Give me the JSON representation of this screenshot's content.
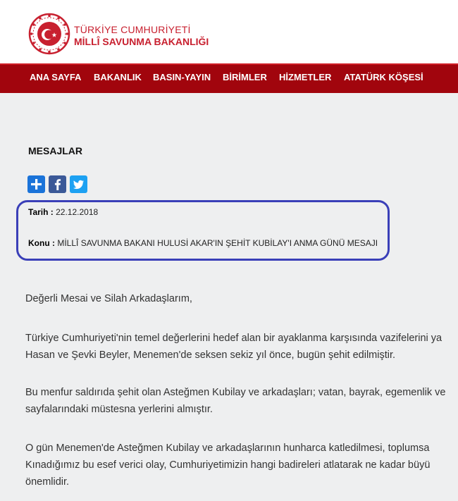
{
  "header": {
    "brand_line1": "TÜRKİYE CUMHURİYETİ",
    "brand_line2": "MİLLÎ SAVUNMA BAKANLIĞI",
    "logo_icon": "crescent-star-emblem-icon",
    "colors": {
      "brand": "#c8202f",
      "nav_bg": "#a1050d",
      "highlight": "#3a3fb8"
    }
  },
  "nav": {
    "items": [
      {
        "label": "ANA SAYFA"
      },
      {
        "label": "BAKANLIK"
      },
      {
        "label": "BASIN-YAYIN"
      },
      {
        "label": "BİRİMLER"
      },
      {
        "label": "HİZMETLER"
      },
      {
        "label": "ATATÜRK KÖŞESİ"
      }
    ]
  },
  "main": {
    "section_title": "MESAJLAR",
    "share_icons": [
      "plus-share-icon",
      "facebook-icon",
      "twitter-icon"
    ],
    "date_label": "Tarih :",
    "date_value": "22.12.2018",
    "subject_label": "Konu :",
    "subject_value": "MİLLÎ SAVUNMA BAKANI HULUSİ AKAR'IN ŞEHİT KUBİLAY'I ANMA GÜNÜ MESAJI",
    "paragraphs": [
      {
        "lines": [
          "Değerli Mesai ve Silah Arkadaşlarım,"
        ]
      },
      {
        "lines": [
          "Türkiye Cumhuriyeti'nin temel değerlerini hedef alan bir ayaklanma karşısında vazifelerini ya",
          "Hasan ve Şevki Beyler, Menemen'de seksen sekiz yıl önce, bugün şehit edilmiştir."
        ]
      },
      {
        "lines": [
          "Bu menfur saldırıda şehit olan Asteğmen Kubilay ve arkadaşları; vatan, bayrak, egemenlik ve",
          "sayfalarındaki müstesna yerlerini almıştır."
        ]
      },
      {
        "lines": [
          "O gün Menemen'de Asteğmen Kubilay ve arkadaşlarının hunharca katledilmesi, toplumsa",
          "Kınadığımız bu esef verici olay, Cumhuriyetimizin hangi badireleri atlatarak ne kadar büyü",
          "önemlidir."
        ]
      }
    ]
  }
}
